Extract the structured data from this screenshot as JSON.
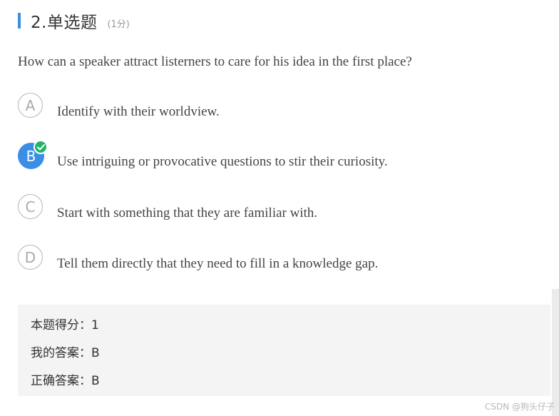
{
  "question": {
    "number_title": "2.单选题",
    "score": "(1分)",
    "text": "How can a speaker attract listerners to care for his idea in the first place?"
  },
  "options": [
    {
      "letter": "A",
      "text": "Identify with their worldview.",
      "selected": false
    },
    {
      "letter": "B",
      "text": "Use intriguing or provocative questions to stir their curiosity.",
      "selected": true
    },
    {
      "letter": "C",
      "text": "Start with something that they are familiar with.",
      "selected": false
    },
    {
      "letter": "D",
      "text": "Tell them directly that they need to fill in a knowledge gap.",
      "selected": false
    }
  ],
  "result": {
    "score_line": "本题得分：1",
    "my_answer_line": "我的答案：B",
    "correct_answer_line": "正确答案：B"
  },
  "watermark": "CSDN @狗头仔子",
  "icons": {
    "selected_check": "check-icon"
  },
  "colors": {
    "accent": "#3a8ee6",
    "correct": "#21b36a",
    "result_bg": "#f4f4f4"
  }
}
